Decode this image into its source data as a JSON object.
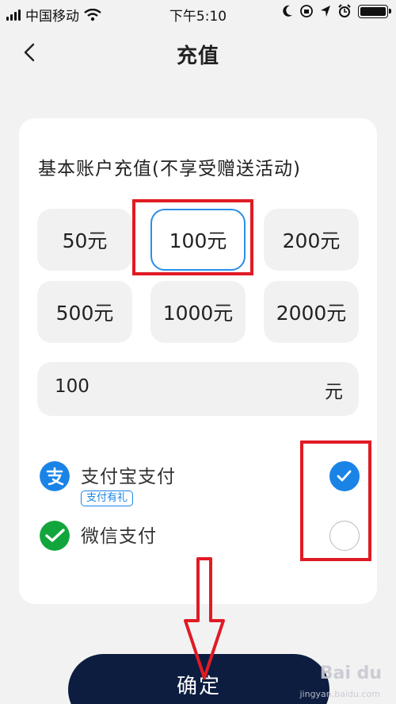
{
  "status_bar": {
    "carrier": "中国移动",
    "time": "下午5:10"
  },
  "header": {
    "title": "充值"
  },
  "recharge": {
    "section_title": "基本账户充值(不享受赠送活动)",
    "amounts": [
      {
        "label": "50元",
        "selected": false
      },
      {
        "label": "100元",
        "selected": true
      },
      {
        "label": "200元",
        "selected": false
      },
      {
        "label": "500元",
        "selected": false
      },
      {
        "label": "1000元",
        "selected": false
      },
      {
        "label": "2000元",
        "selected": false
      }
    ],
    "custom_amount": {
      "value": "100",
      "unit": "元"
    }
  },
  "payment_methods": [
    {
      "label": "支付宝支付",
      "tag": "支付有礼",
      "checked": true,
      "icon": "alipay-icon",
      "color": "#1a84e6"
    },
    {
      "label": "微信支付",
      "tag": "",
      "checked": false,
      "icon": "wechat-pay-icon",
      "color": "#12a53c"
    }
  ],
  "confirm": {
    "label": "确定"
  },
  "watermark": {
    "brand": "Bai du",
    "sub": "jingyan.baidu.com"
  },
  "colors": {
    "accent": "#1a84e6",
    "confirm_bg": "#0c1d40",
    "annotation": "#e01b24"
  }
}
